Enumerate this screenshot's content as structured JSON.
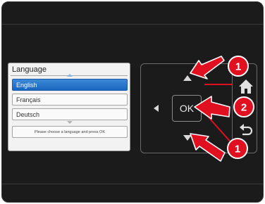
{
  "dialog": {
    "title": "Language",
    "options": [
      {
        "label": "English",
        "selected": true
      },
      {
        "label": "Français",
        "selected": false
      },
      {
        "label": "Deutsch",
        "selected": false
      }
    ],
    "hint": "Please choose a language and press OK"
  },
  "controls": {
    "ok_label": "OK",
    "icons": [
      "arrow-up-icon",
      "arrow-down-icon",
      "arrow-left-icon",
      "arrow-right-icon",
      "home-icon",
      "back-icon"
    ]
  },
  "callouts": [
    {
      "number": "1",
      "target": "up-arrow"
    },
    {
      "number": "2",
      "target": "ok-button"
    },
    {
      "number": "1",
      "target": "down-arrow"
    }
  ],
  "colors": {
    "screen_bg": "#1b1b1b",
    "selected_item": "#1a66bf",
    "callout_red": "#e01020"
  }
}
